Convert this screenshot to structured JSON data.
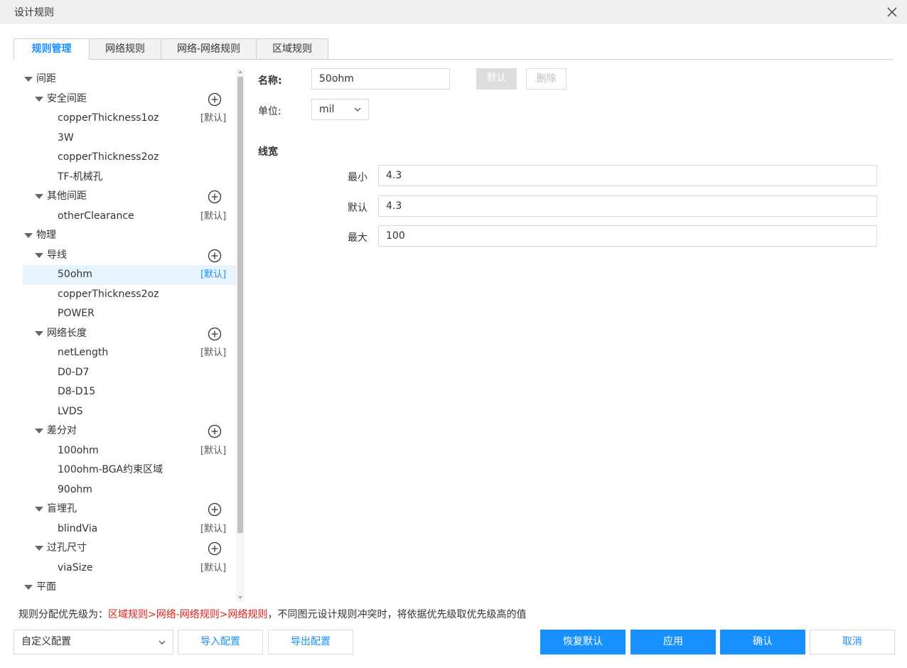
{
  "window": {
    "title": "设计规则"
  },
  "tabs": [
    {
      "label": "规则管理",
      "active": true
    },
    {
      "label": "网络规则"
    },
    {
      "label": "网络-网络规则"
    },
    {
      "label": "区域规则"
    }
  ],
  "tree": {
    "rows": [
      {
        "text": "间距"
      },
      {
        "text": "安全间距"
      },
      {
        "text": "copperThickness1oz",
        "badge": "[默认]"
      },
      {
        "text": "3W"
      },
      {
        "text": "copperThickness2oz"
      },
      {
        "text": "TF-机械孔"
      },
      {
        "text": "其他间距"
      },
      {
        "text": "otherClearance",
        "badge": "[默认]"
      },
      {
        "text": "物理"
      },
      {
        "text": "导线"
      },
      {
        "text": "50ohm",
        "badge": "[默认]"
      },
      {
        "text": "copperThickness2oz"
      },
      {
        "text": "POWER"
      },
      {
        "text": "网络长度"
      },
      {
        "text": "netLength",
        "badge": "[默认]"
      },
      {
        "text": "D0-D7"
      },
      {
        "text": "D8-D15"
      },
      {
        "text": "LVDS"
      },
      {
        "text": "差分对"
      },
      {
        "text": "100ohm",
        "badge": "[默认]"
      },
      {
        "text": "100ohm-BGA约束区域"
      },
      {
        "text": "90ohm"
      },
      {
        "text": "盲埋孔"
      },
      {
        "text": "blindVia",
        "badge": "[默认]"
      },
      {
        "text": "过孔尺寸"
      },
      {
        "text": "viaSize",
        "badge": "[默认]"
      },
      {
        "text": "平面"
      }
    ]
  },
  "form": {
    "name_label": "名称:",
    "name_value": "50ohm",
    "default_button": "默认",
    "delete_button": "删除",
    "unit_label": "单位:",
    "unit_value": "mil",
    "section_title": "线宽",
    "min_label": "最小",
    "min_value": "4.3",
    "default_label": "默认",
    "default_value": "4.3",
    "max_label": "最大",
    "max_value": "100"
  },
  "footer": {
    "note_prefix": "规则分配优先级为：",
    "note_priority": "区域规则>网络-网络规则>网络规则",
    "note_suffix": "，不同图元设计规则冲突时，将依据优先级取优先级高的值",
    "config_select": "自定义配置",
    "import_button": "导入配置",
    "export_button": "导出配置",
    "restore_button": "恢复默认",
    "apply_button": "应用",
    "confirm_button": "确认",
    "cancel_button": "取消"
  },
  "colors": {
    "accent": "#1890ff",
    "priority_text": "#e02020",
    "selected_row_bg": "#e8f4fd",
    "titlebar_bg": "#efefef"
  },
  "icons": {
    "close": "close-icon",
    "add": "plus-circle-icon",
    "expand": "caret-down-icon",
    "select": "chevron-down-icon"
  }
}
